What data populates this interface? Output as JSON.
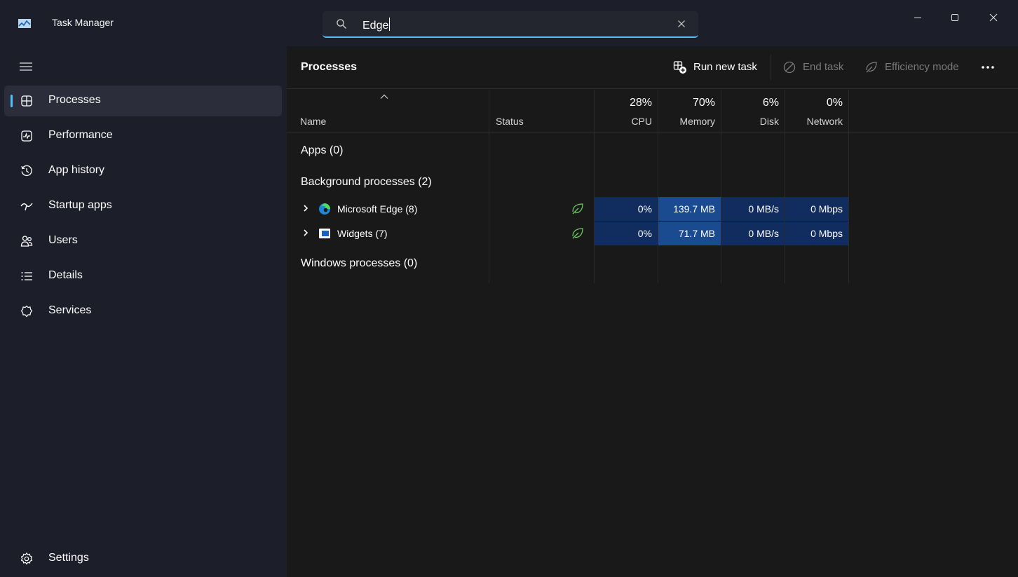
{
  "app": {
    "title": "Task Manager"
  },
  "search": {
    "value": "Edge"
  },
  "sidebar": {
    "items": [
      {
        "label": "Processes",
        "icon": "processes-icon",
        "active": true
      },
      {
        "label": "Performance",
        "icon": "performance-icon"
      },
      {
        "label": "App history",
        "icon": "app-history-icon"
      },
      {
        "label": "Startup apps",
        "icon": "startup-apps-icon"
      },
      {
        "label": "Users",
        "icon": "users-icon"
      },
      {
        "label": "Details",
        "icon": "details-icon"
      },
      {
        "label": "Services",
        "icon": "services-icon"
      }
    ],
    "settings_label": "Settings"
  },
  "toolbar": {
    "title": "Processes",
    "run_new_task": "Run new task",
    "end_task": "End task",
    "efficiency_mode": "Efficiency mode"
  },
  "table": {
    "columns": {
      "name": "Name",
      "status": "Status",
      "cpu": {
        "percent": "28%",
        "label": "CPU"
      },
      "memory": {
        "percent": "70%",
        "label": "Memory"
      },
      "disk": {
        "percent": "6%",
        "label": "Disk"
      },
      "network": {
        "percent": "0%",
        "label": "Network"
      }
    },
    "groups": {
      "apps": "Apps (0)",
      "background": "Background processes (2)",
      "windows": "Windows processes (0)"
    },
    "rows": [
      {
        "name": "Microsoft Edge (8)",
        "icon": "edge-icon",
        "efficiency": true,
        "cpu": "0%",
        "memory": "139.7 MB",
        "disk": "0 MB/s",
        "network": "0 Mbps"
      },
      {
        "name": "Widgets (7)",
        "icon": "widgets-icon",
        "efficiency": true,
        "cpu": "0%",
        "memory": "71.7 MB",
        "disk": "0 MB/s",
        "network": "0 Mbps"
      }
    ]
  },
  "colors": {
    "accent": "#4cc2ff",
    "efficiency_leaf": "#6ccb5f",
    "heat_light": "#112d5f",
    "heat_strong": "#1a4a90"
  }
}
